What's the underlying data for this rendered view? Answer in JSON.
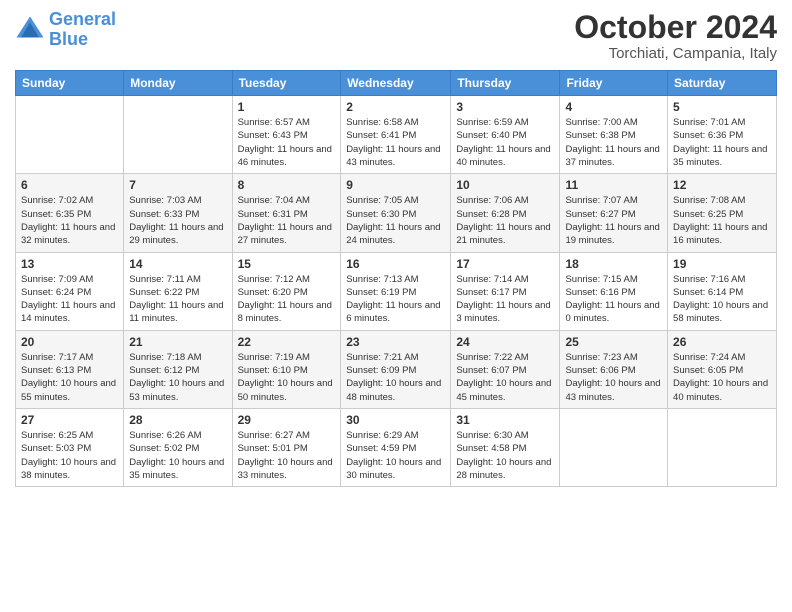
{
  "logo": {
    "line1": "General",
    "line2": "Blue"
  },
  "header": {
    "month": "October 2024",
    "location": "Torchiati, Campania, Italy"
  },
  "weekdays": [
    "Sunday",
    "Monday",
    "Tuesday",
    "Wednesday",
    "Thursday",
    "Friday",
    "Saturday"
  ],
  "weeks": [
    [
      null,
      null,
      {
        "day": "1",
        "sunrise": "Sunrise: 6:57 AM",
        "sunset": "Sunset: 6:43 PM",
        "daylight": "Daylight: 11 hours and 46 minutes."
      },
      {
        "day": "2",
        "sunrise": "Sunrise: 6:58 AM",
        "sunset": "Sunset: 6:41 PM",
        "daylight": "Daylight: 11 hours and 43 minutes."
      },
      {
        "day": "3",
        "sunrise": "Sunrise: 6:59 AM",
        "sunset": "Sunset: 6:40 PM",
        "daylight": "Daylight: 11 hours and 40 minutes."
      },
      {
        "day": "4",
        "sunrise": "Sunrise: 7:00 AM",
        "sunset": "Sunset: 6:38 PM",
        "daylight": "Daylight: 11 hours and 37 minutes."
      },
      {
        "day": "5",
        "sunrise": "Sunrise: 7:01 AM",
        "sunset": "Sunset: 6:36 PM",
        "daylight": "Daylight: 11 hours and 35 minutes."
      }
    ],
    [
      {
        "day": "6",
        "sunrise": "Sunrise: 7:02 AM",
        "sunset": "Sunset: 6:35 PM",
        "daylight": "Daylight: 11 hours and 32 minutes."
      },
      {
        "day": "7",
        "sunrise": "Sunrise: 7:03 AM",
        "sunset": "Sunset: 6:33 PM",
        "daylight": "Daylight: 11 hours and 29 minutes."
      },
      {
        "day": "8",
        "sunrise": "Sunrise: 7:04 AM",
        "sunset": "Sunset: 6:31 PM",
        "daylight": "Daylight: 11 hours and 27 minutes."
      },
      {
        "day": "9",
        "sunrise": "Sunrise: 7:05 AM",
        "sunset": "Sunset: 6:30 PM",
        "daylight": "Daylight: 11 hours and 24 minutes."
      },
      {
        "day": "10",
        "sunrise": "Sunrise: 7:06 AM",
        "sunset": "Sunset: 6:28 PM",
        "daylight": "Daylight: 11 hours and 21 minutes."
      },
      {
        "day": "11",
        "sunrise": "Sunrise: 7:07 AM",
        "sunset": "Sunset: 6:27 PM",
        "daylight": "Daylight: 11 hours and 19 minutes."
      },
      {
        "day": "12",
        "sunrise": "Sunrise: 7:08 AM",
        "sunset": "Sunset: 6:25 PM",
        "daylight": "Daylight: 11 hours and 16 minutes."
      }
    ],
    [
      {
        "day": "13",
        "sunrise": "Sunrise: 7:09 AM",
        "sunset": "Sunset: 6:24 PM",
        "daylight": "Daylight: 11 hours and 14 minutes."
      },
      {
        "day": "14",
        "sunrise": "Sunrise: 7:11 AM",
        "sunset": "Sunset: 6:22 PM",
        "daylight": "Daylight: 11 hours and 11 minutes."
      },
      {
        "day": "15",
        "sunrise": "Sunrise: 7:12 AM",
        "sunset": "Sunset: 6:20 PM",
        "daylight": "Daylight: 11 hours and 8 minutes."
      },
      {
        "day": "16",
        "sunrise": "Sunrise: 7:13 AM",
        "sunset": "Sunset: 6:19 PM",
        "daylight": "Daylight: 11 hours and 6 minutes."
      },
      {
        "day": "17",
        "sunrise": "Sunrise: 7:14 AM",
        "sunset": "Sunset: 6:17 PM",
        "daylight": "Daylight: 11 hours and 3 minutes."
      },
      {
        "day": "18",
        "sunrise": "Sunrise: 7:15 AM",
        "sunset": "Sunset: 6:16 PM",
        "daylight": "Daylight: 11 hours and 0 minutes."
      },
      {
        "day": "19",
        "sunrise": "Sunrise: 7:16 AM",
        "sunset": "Sunset: 6:14 PM",
        "daylight": "Daylight: 10 hours and 58 minutes."
      }
    ],
    [
      {
        "day": "20",
        "sunrise": "Sunrise: 7:17 AM",
        "sunset": "Sunset: 6:13 PM",
        "daylight": "Daylight: 10 hours and 55 minutes."
      },
      {
        "day": "21",
        "sunrise": "Sunrise: 7:18 AM",
        "sunset": "Sunset: 6:12 PM",
        "daylight": "Daylight: 10 hours and 53 minutes."
      },
      {
        "day": "22",
        "sunrise": "Sunrise: 7:19 AM",
        "sunset": "Sunset: 6:10 PM",
        "daylight": "Daylight: 10 hours and 50 minutes."
      },
      {
        "day": "23",
        "sunrise": "Sunrise: 7:21 AM",
        "sunset": "Sunset: 6:09 PM",
        "daylight": "Daylight: 10 hours and 48 minutes."
      },
      {
        "day": "24",
        "sunrise": "Sunrise: 7:22 AM",
        "sunset": "Sunset: 6:07 PM",
        "daylight": "Daylight: 10 hours and 45 minutes."
      },
      {
        "day": "25",
        "sunrise": "Sunrise: 7:23 AM",
        "sunset": "Sunset: 6:06 PM",
        "daylight": "Daylight: 10 hours and 43 minutes."
      },
      {
        "day": "26",
        "sunrise": "Sunrise: 7:24 AM",
        "sunset": "Sunset: 6:05 PM",
        "daylight": "Daylight: 10 hours and 40 minutes."
      }
    ],
    [
      {
        "day": "27",
        "sunrise": "Sunrise: 6:25 AM",
        "sunset": "Sunset: 5:03 PM",
        "daylight": "Daylight: 10 hours and 38 minutes."
      },
      {
        "day": "28",
        "sunrise": "Sunrise: 6:26 AM",
        "sunset": "Sunset: 5:02 PM",
        "daylight": "Daylight: 10 hours and 35 minutes."
      },
      {
        "day": "29",
        "sunrise": "Sunrise: 6:27 AM",
        "sunset": "Sunset: 5:01 PM",
        "daylight": "Daylight: 10 hours and 33 minutes."
      },
      {
        "day": "30",
        "sunrise": "Sunrise: 6:29 AM",
        "sunset": "Sunset: 4:59 PM",
        "daylight": "Daylight: 10 hours and 30 minutes."
      },
      {
        "day": "31",
        "sunrise": "Sunrise: 6:30 AM",
        "sunset": "Sunset: 4:58 PM",
        "daylight": "Daylight: 10 hours and 28 minutes."
      },
      null,
      null
    ]
  ]
}
